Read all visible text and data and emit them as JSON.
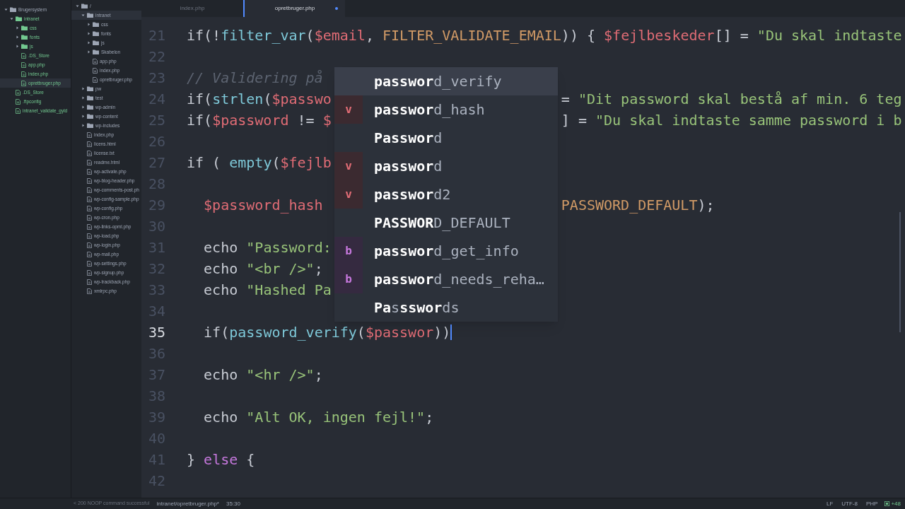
{
  "project_tree": [
    {
      "name": "Brugersystem",
      "kind": "folder",
      "expanded": true,
      "new": false,
      "selected": false,
      "children": [
        {
          "name": "intranet",
          "kind": "folder",
          "expanded": true,
          "new": true,
          "selected": false,
          "children": [
            {
              "name": "css",
              "kind": "folder",
              "expanded": false,
              "new": true,
              "selected": false
            },
            {
              "name": "fonts",
              "kind": "folder",
              "expanded": false,
              "new": true,
              "selected": false
            },
            {
              "name": "js",
              "kind": "folder",
              "expanded": false,
              "new": true,
              "selected": false
            },
            {
              "name": ".DS_Store",
              "kind": "file",
              "new": true,
              "selected": false
            },
            {
              "name": "app.php",
              "kind": "file",
              "new": true,
              "selected": false
            },
            {
              "name": "index.php",
              "kind": "file",
              "new": true,
              "selected": false
            },
            {
              "name": "opretbruger.php",
              "kind": "file",
              "new": true,
              "selected": true
            }
          ]
        },
        {
          "name": ".DS_Store",
          "kind": "file",
          "new": true,
          "selected": false
        },
        {
          "name": ".ftpconfig",
          "kind": "file",
          "new": true,
          "selected": false
        },
        {
          "name": "intranet_validate_gyld",
          "kind": "file",
          "new": true,
          "selected": false
        }
      ]
    }
  ],
  "remote_tree": [
    {
      "name": "/",
      "kind": "folder",
      "expanded": true,
      "new": false,
      "selected": false,
      "children": [
        {
          "name": "intranet",
          "kind": "folder",
          "expanded": true,
          "new": false,
          "selected": true,
          "children": [
            {
              "name": "css",
              "kind": "folder",
              "expanded": false,
              "new": false,
              "selected": false
            },
            {
              "name": "fonts",
              "kind": "folder",
              "expanded": false,
              "new": false,
              "selected": false
            },
            {
              "name": "js",
              "kind": "folder",
              "expanded": false,
              "new": false,
              "selected": false
            },
            {
              "name": "Skabelon",
              "kind": "folder",
              "expanded": false,
              "new": false,
              "selected": false
            },
            {
              "name": "app.php",
              "kind": "file",
              "new": false,
              "selected": false
            },
            {
              "name": "index.php",
              "kind": "file",
              "new": false,
              "selected": false
            },
            {
              "name": "opretbruger.php",
              "kind": "file",
              "new": false,
              "selected": false
            }
          ]
        },
        {
          "name": "pw",
          "kind": "folder",
          "expanded": false,
          "new": false,
          "selected": false
        },
        {
          "name": "test",
          "kind": "folder",
          "expanded": false,
          "new": false,
          "selected": false
        },
        {
          "name": "wp-admin",
          "kind": "folder",
          "expanded": false,
          "new": false,
          "selected": false
        },
        {
          "name": "wp-content",
          "kind": "folder",
          "expanded": false,
          "new": false,
          "selected": false
        },
        {
          "name": "wp-includes",
          "kind": "folder",
          "expanded": false,
          "new": false,
          "selected": false
        },
        {
          "name": "index.php",
          "kind": "file",
          "new": false,
          "selected": false
        },
        {
          "name": "licens.html",
          "kind": "file",
          "new": false,
          "selected": false
        },
        {
          "name": "license.txt",
          "kind": "file",
          "new": false,
          "selected": false
        },
        {
          "name": "readme.html",
          "kind": "file",
          "new": false,
          "selected": false
        },
        {
          "name": "wp-activate.php",
          "kind": "file",
          "new": false,
          "selected": false
        },
        {
          "name": "wp-blog-header.php",
          "kind": "file",
          "new": false,
          "selected": false
        },
        {
          "name": "wp-comments-post.ph",
          "kind": "file",
          "new": false,
          "selected": false
        },
        {
          "name": "wp-config-sample.php",
          "kind": "file",
          "new": false,
          "selected": false
        },
        {
          "name": "wp-config.php",
          "kind": "file",
          "new": false,
          "selected": false
        },
        {
          "name": "wp-cron.php",
          "kind": "file",
          "new": false,
          "selected": false
        },
        {
          "name": "wp-links-opml.php",
          "kind": "file",
          "new": false,
          "selected": false
        },
        {
          "name": "wp-load.php",
          "kind": "file",
          "new": false,
          "selected": false
        },
        {
          "name": "wp-login.php",
          "kind": "file",
          "new": false,
          "selected": false
        },
        {
          "name": "wp-mail.php",
          "kind": "file",
          "new": false,
          "selected": false
        },
        {
          "name": "wp-settings.php",
          "kind": "file",
          "new": false,
          "selected": false
        },
        {
          "name": "wp-signup.php",
          "kind": "file",
          "new": false,
          "selected": false
        },
        {
          "name": "wp-trackback.php",
          "kind": "file",
          "new": false,
          "selected": false
        },
        {
          "name": "xmlrpc.php",
          "kind": "file",
          "new": false,
          "selected": false
        }
      ]
    }
  ],
  "tabs": [
    {
      "label": "index.php",
      "selected": false,
      "modified": false
    },
    {
      "label": "opretbruger.php",
      "selected": true,
      "modified": true
    }
  ],
  "code_lines": [
    {
      "number": "21",
      "current": false,
      "tokens": [
        {
          "text": "if(!",
          "kind": "plain"
        },
        {
          "text": "filter_var",
          "kind": "function"
        },
        {
          "text": "(",
          "kind": "plain"
        },
        {
          "text": "$email",
          "kind": "variable"
        },
        {
          "text": ", ",
          "kind": "plain"
        },
        {
          "text": "FILTER_VALIDATE_EMAIL",
          "kind": "constant"
        },
        {
          "text": ")) { ",
          "kind": "plain"
        },
        {
          "text": "$fejlbeskeder",
          "kind": "variable"
        },
        {
          "text": "[] = ",
          "kind": "plain"
        },
        {
          "text": "\"Du skal indtaste",
          "kind": "string"
        }
      ]
    },
    {
      "number": "22",
      "current": false
    },
    {
      "number": "23",
      "current": false,
      "tokens": [
        {
          "text": "// Validering på",
          "kind": "comment"
        }
      ]
    },
    {
      "number": "24",
      "current": false,
      "tokens": [
        {
          "text": "if(",
          "kind": "plain"
        },
        {
          "text": "strlen",
          "kind": "function"
        },
        {
          "text": "(",
          "kind": "plain"
        },
        {
          "text": "$passwo",
          "kind": "variable"
        }
      ],
      "after_popup": [
        {
          "text": "= ",
          "kind": "plain"
        },
        {
          "text": "\"Dit password skal bestå af min. 6 teg",
          "kind": "string"
        }
      ]
    },
    {
      "number": "25",
      "current": false,
      "tokens": [
        {
          "text": "if(",
          "kind": "plain"
        },
        {
          "text": "$password",
          "kind": "variable"
        },
        {
          "text": " != ",
          "kind": "plain"
        },
        {
          "text": "$",
          "kind": "variable"
        }
      ],
      "after_popup": [
        {
          "text": "] = ",
          "kind": "plain"
        },
        {
          "text": "\"Du skal indtaste samme password i b",
          "kind": "string"
        }
      ]
    },
    {
      "number": "26",
      "current": false
    },
    {
      "number": "27",
      "current": false,
      "tokens": [
        {
          "text": "if ( ",
          "kind": "plain"
        },
        {
          "text": "empty",
          "kind": "function"
        },
        {
          "text": "(",
          "kind": "plain"
        },
        {
          "text": "$fejlb",
          "kind": "variable"
        }
      ]
    },
    {
      "number": "28",
      "current": false
    },
    {
      "number": "29",
      "current": false,
      "tokens": [
        {
          "text": "  $password_hash",
          "kind": "variable"
        }
      ],
      "after_popup": [
        {
          "text": "PASSWORD_DEFAULT",
          "kind": "constant"
        },
        {
          "text": ");",
          "kind": "plain"
        }
      ]
    },
    {
      "number": "30",
      "current": false
    },
    {
      "number": "31",
      "current": false,
      "tokens": [
        {
          "text": "  echo ",
          "kind": "plain"
        },
        {
          "text": "\"Password:",
          "kind": "string"
        }
      ]
    },
    {
      "number": "32",
      "current": false,
      "tokens": [
        {
          "text": "  echo ",
          "kind": "plain"
        },
        {
          "text": "\"<br />\"",
          "kind": "string"
        },
        {
          "text": ";",
          "kind": "plain"
        }
      ]
    },
    {
      "number": "33",
      "current": false,
      "tokens": [
        {
          "text": "  echo ",
          "kind": "plain"
        },
        {
          "text": "\"Hashed Pa",
          "kind": "string"
        }
      ]
    },
    {
      "number": "34",
      "current": false
    },
    {
      "number": "35",
      "current": true,
      "tokens": [
        {
          "text": "  if(",
          "kind": "plain"
        },
        {
          "text": "password_verify",
          "kind": "function"
        },
        {
          "text": "(",
          "kind": "plain"
        },
        {
          "text": "$passwor",
          "kind": "variable"
        },
        {
          "text": "))",
          "kind": "plain"
        }
      ]
    },
    {
      "number": "36",
      "current": false
    },
    {
      "number": "37",
      "current": false,
      "tokens": [
        {
          "text": "  echo ",
          "kind": "plain"
        },
        {
          "text": "\"<hr />\"",
          "kind": "string"
        },
        {
          "text": ";",
          "kind": "plain"
        }
      ]
    },
    {
      "number": "38",
      "current": false
    },
    {
      "number": "39",
      "current": false,
      "tokens": [
        {
          "text": "  echo ",
          "kind": "plain"
        },
        {
          "text": "\"Alt OK, ingen fejl!\"",
          "kind": "string"
        },
        {
          "text": ";",
          "kind": "plain"
        }
      ]
    },
    {
      "number": "40",
      "current": false
    },
    {
      "number": "41",
      "current": false,
      "tokens": [
        {
          "text": "} ",
          "kind": "plain"
        },
        {
          "text": "else",
          "kind": "keyword"
        },
        {
          "text": " {",
          "kind": "plain"
        }
      ]
    },
    {
      "number": "42",
      "current": false
    }
  ],
  "autocomplete": [
    {
      "text": "**passwor**d_verify",
      "kind": "plain",
      "selected": true
    },
    {
      "text": "**passwor**d_hash",
      "badge": "v",
      "kind": "variable",
      "selected": false
    },
    {
      "text": "**Passwor**d",
      "kind": "plain",
      "selected": false
    },
    {
      "text": "**passwor**d",
      "badge": "v",
      "kind": "variable",
      "selected": false
    },
    {
      "text": "**passwor**d2",
      "badge": "v",
      "kind": "variable",
      "selected": false
    },
    {
      "text": "**PASSWOR**D_DEFAULT",
      "kind": "plain",
      "selected": false
    },
    {
      "text": "**passwor**d_get_info",
      "badge": "b",
      "kind": "builtin",
      "selected": false
    },
    {
      "text": "**passwor**d_needs_reha…",
      "badge": "b",
      "kind": "builtin",
      "selected": false
    },
    {
      "text": "**Pa**s**sswor**ds",
      "kind": "plain",
      "selected": false
    }
  ],
  "status_bar": {
    "message": "< 200 NOOP command successful",
    "file": "intranet/opretbruger.php*",
    "position": "35:30",
    "line_ending": "LF",
    "encoding": "UTF-8",
    "grammar": "PHP",
    "git_changes": "+48"
  }
}
